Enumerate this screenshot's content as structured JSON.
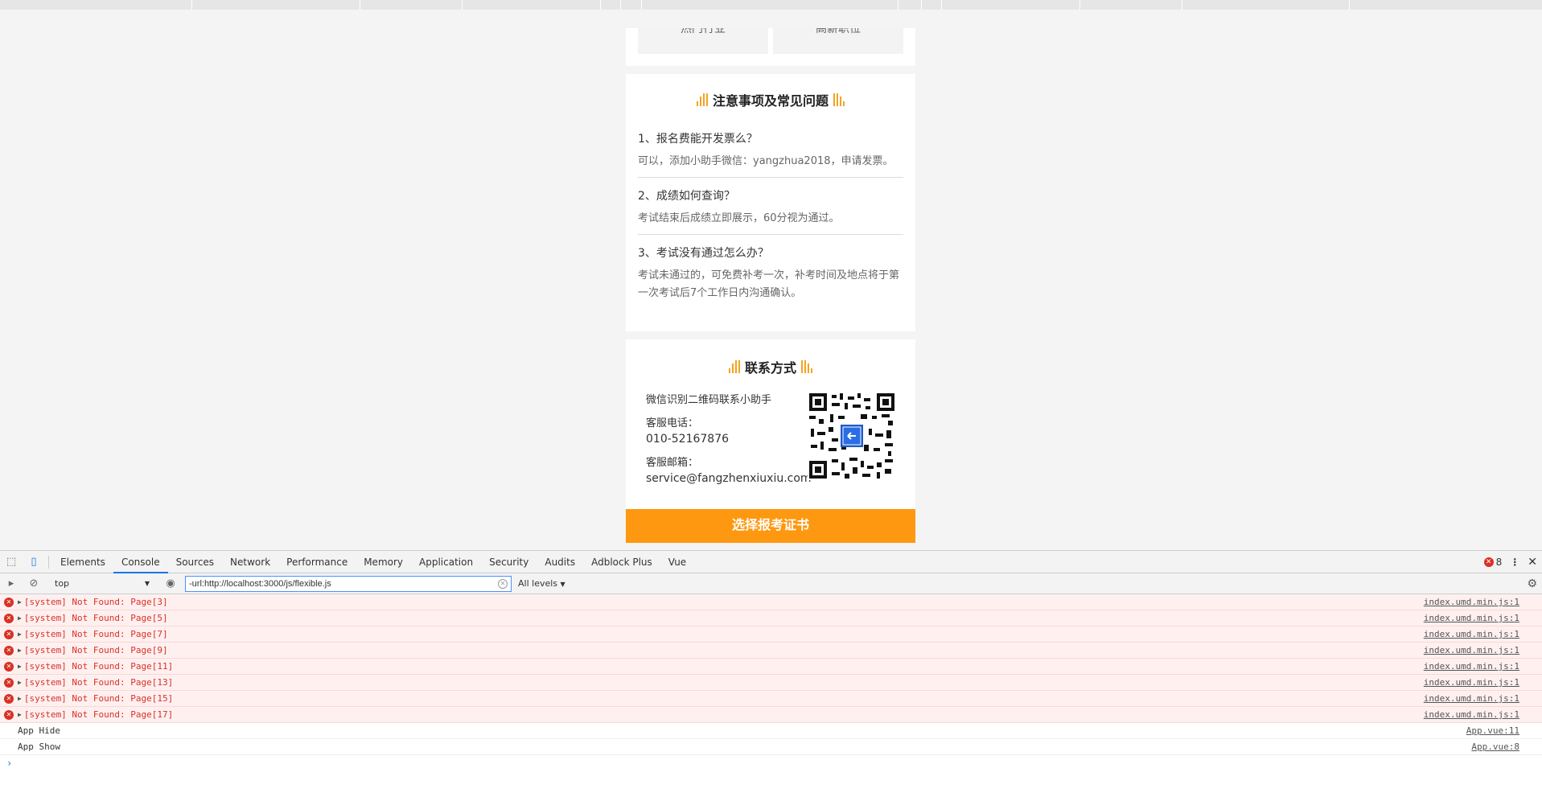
{
  "page": {
    "top_cells": [
      "热门行业",
      "高薪职位"
    ],
    "faq": {
      "title": "注意事项及常见问题",
      "items": [
        {
          "q": "1、报名费能开发票么？",
          "a": "可以，添加小助手微信：yangzhua2018，申请发票。"
        },
        {
          "q": "2、成绩如何查询？",
          "a": "考试结束后成绩立即展示，60分视为通过。"
        },
        {
          "q": "3、考试没有通过怎么办？",
          "a": "考试未通过的，可免费补考一次，补考时间及地点将于第一次考试后7个工作日内沟通确认。"
        }
      ]
    },
    "contact": {
      "title": "联系方式",
      "wechat_text": "微信识别二维码联系小助手",
      "phone_label": "客服电话：",
      "phone": "010-52167876",
      "email_label": "客服邮箱：",
      "email": "service@fangzhenxiuxiu.com"
    },
    "cta_label": "选择报考证书",
    "accent_color": "#fd9810"
  },
  "devtools": {
    "tabs": [
      "Elements",
      "Console",
      "Sources",
      "Network",
      "Performance",
      "Memory",
      "Application",
      "Security",
      "Audits",
      "Adblock Plus",
      "Vue"
    ],
    "active_tab": "Console",
    "error_count": "8",
    "context": "top",
    "filter_value": "-url:http://localhost:3000/js/flexible.js",
    "levels": "All levels",
    "logs": [
      {
        "type": "error",
        "msg": "[system] Not Found: Page[3]",
        "src": "index.umd.min.js:1"
      },
      {
        "type": "error",
        "msg": "[system] Not Found: Page[5]",
        "src": "index.umd.min.js:1"
      },
      {
        "type": "error",
        "msg": "[system] Not Found: Page[7]",
        "src": "index.umd.min.js:1"
      },
      {
        "type": "error",
        "msg": "[system] Not Found: Page[9]",
        "src": "index.umd.min.js:1"
      },
      {
        "type": "error",
        "msg": "[system] Not Found: Page[11]",
        "src": "index.umd.min.js:1"
      },
      {
        "type": "error",
        "msg": "[system] Not Found: Page[13]",
        "src": "index.umd.min.js:1"
      },
      {
        "type": "error",
        "msg": "[system] Not Found: Page[15]",
        "src": "index.umd.min.js:1"
      },
      {
        "type": "error",
        "msg": "[system] Not Found: Page[17]",
        "src": "index.umd.min.js:1"
      },
      {
        "type": "info",
        "msg": "App Hide",
        "src": "App.vue:11"
      },
      {
        "type": "info",
        "msg": "App Show",
        "src": "App.vue:8"
      }
    ]
  }
}
